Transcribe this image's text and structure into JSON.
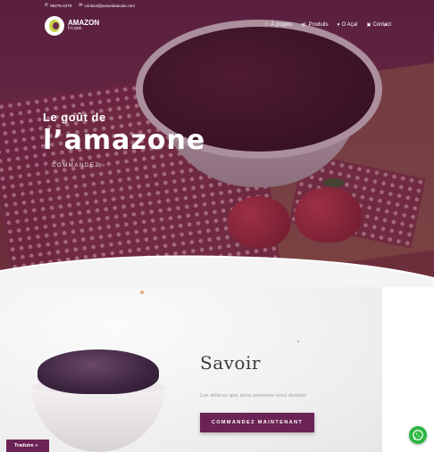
{
  "topbar": {
    "phone": "99278-4379",
    "email": "contact@puravidaacais.com"
  },
  "logo": {
    "name": "AMAZON",
    "sub": "Fo pas"
  },
  "nav": {
    "items": [
      {
        "label": "À propos",
        "icon": "info-icon"
      },
      {
        "label": "Produits",
        "icon": "cart-icon"
      },
      {
        "label": "O Açaí",
        "icon": "heart-icon"
      },
      {
        "label": "Contact",
        "icon": "chat-icon"
      }
    ],
    "search_icon": "search-icon"
  },
  "hero": {
    "line1": "Le goût de",
    "line2": "l’amazone",
    "cta": "COMMANDEZ ›"
  },
  "section2": {
    "title": "Savoir",
    "tagline": "Les délices que nous pouvons vous donner",
    "cta": "COMMANDEZ MAINTENANT"
  },
  "translate_button": "Traduire »",
  "whatsapp_icon": "whatsapp-icon",
  "colors": {
    "brand": "#6b2355",
    "whatsapp": "#2bb741"
  }
}
